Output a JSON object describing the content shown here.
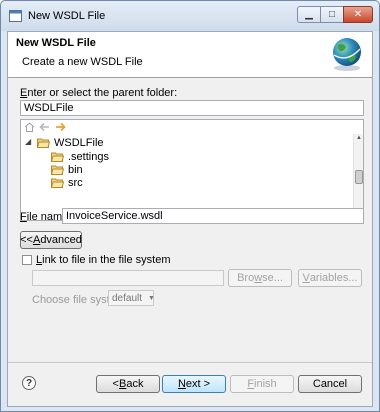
{
  "window": {
    "title": "New WSDL File"
  },
  "header": {
    "title": "New WSDL File",
    "subtitle": "Create a new WSDL File"
  },
  "parent": {
    "label": "Enter or select the parent folder:",
    "label_mnemonic": "E",
    "label_rest": "nter or select the parent folder:",
    "value": "WSDLFile"
  },
  "tree": {
    "root": {
      "label": "WSDLFile",
      "expanded": true
    },
    "children": [
      {
        "label": ".settings"
      },
      {
        "label": "bin"
      },
      {
        "label": "src"
      }
    ]
  },
  "filename": {
    "label_mnemonic": "F",
    "label_rest": "ile name:",
    "value": "InvoiceService.wsdl"
  },
  "advanced": {
    "label_prefix": "<< ",
    "label_mnemonic": "A",
    "label_rest": "dvanced"
  },
  "link": {
    "label_mnemonic": "L",
    "label_rest": "ink to file in the file system",
    "path_value": "",
    "browse_mnemonic": "w",
    "browse_pre": "Bro",
    "browse_rest": "se...",
    "variables_mnemonic": "V",
    "variables_rest": "ariables...",
    "filesystem_label": "Choose file system:",
    "filesystem_value": "default"
  },
  "footer": {
    "back_label": "< Back",
    "back_pre": "< ",
    "back_mnemonic": "B",
    "back_rest": "ack",
    "next_pre": "",
    "next_mnemonic": "N",
    "next_rest": "ext >",
    "finish_label": "Finish",
    "finish_mnemonic": "F",
    "finish_rest": "inish",
    "cancel_label": "Cancel"
  },
  "colors": {
    "accent": "#3c7fb1",
    "window_frame": "#dbe6f2",
    "folder": "#e8c25a"
  }
}
